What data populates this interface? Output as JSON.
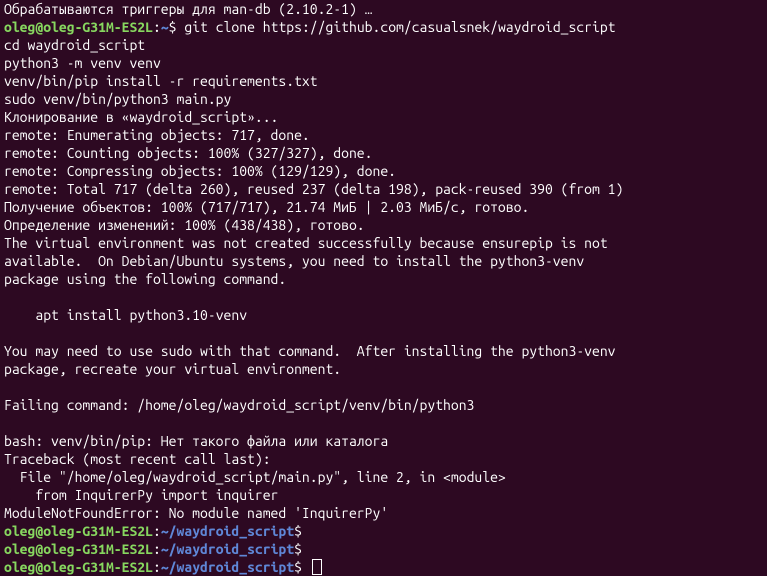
{
  "terminal": {
    "user": "oleg",
    "host": "oleg-G31M-ES2L",
    "home_path": "~",
    "project_path": "~/waydroid_script",
    "lines": {
      "l0": "Обрабатываются триггеры для man-db (2.10.2-1) …",
      "cmd1": "git clone https://github.com/casualsnek/waydroid_script",
      "cmd2": "cd waydroid_script",
      "cmd3": "python3 -m venv venv",
      "cmd4": "venv/bin/pip install -r requirements.txt",
      "cmd5": "sudo venv/bin/python3 main.py",
      "l6": "Клонирование в «waydroid_script»...",
      "l7": "remote: Enumerating objects: 717, done.",
      "l8": "remote: Counting objects: 100% (327/327), done.",
      "l9": "remote: Compressing objects: 100% (129/129), done.",
      "l10": "remote: Total 717 (delta 260), reused 237 (delta 198), pack-reused 390 (from 1)",
      "l11": "Получение объектов: 100% (717/717), 21.74 МиБ | 2.03 МиБ/с, готово.",
      "l12": "Определение изменений: 100% (438/438), готово.",
      "l13": "The virtual environment was not created successfully because ensurepip is not",
      "l14": "available.  On Debian/Ubuntu systems, you need to install the python3-venv",
      "l15": "package using the following command.",
      "l16": "",
      "l17": "    apt install python3.10-venv",
      "l18": "",
      "l19": "You may need to use sudo with that command.  After installing the python3-venv",
      "l20": "package, recreate your virtual environment.",
      "l21": "",
      "l22": "Failing command: /home/oleg/waydroid_script/venv/bin/python3",
      "l23": "",
      "l24": "bash: venv/bin/pip: Нет такого файла или каталога",
      "l25": "Traceback (most recent call last):",
      "l26": "  File \"/home/oleg/waydroid_script/main.py\", line 2, in <module>",
      "l27": "    from InquirerPy import inquirer",
      "l28": "ModuleNotFoundError: No module named 'InquirerPy'"
    }
  }
}
